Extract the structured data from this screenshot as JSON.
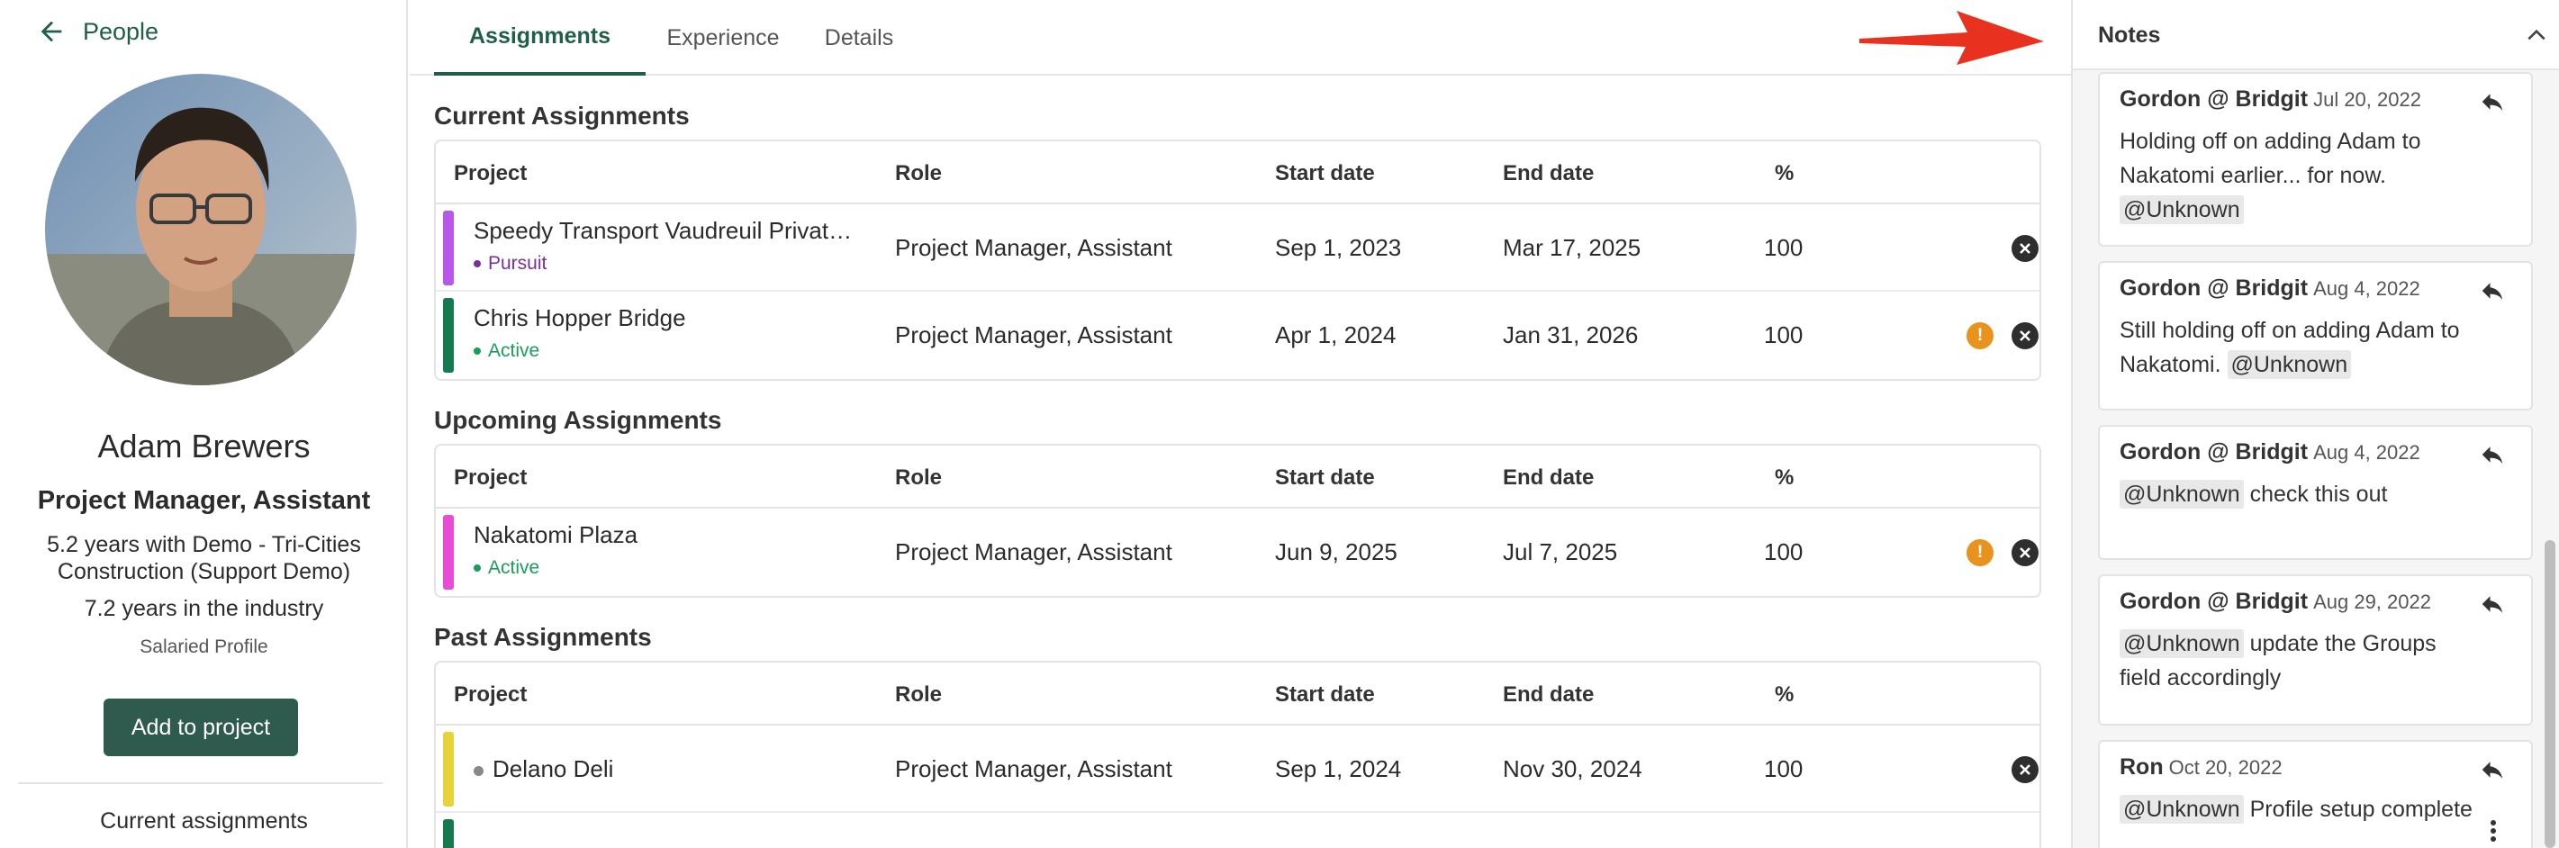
{
  "left_panel": {
    "back_label": "People",
    "name": "Adam Brewers",
    "role": "Project Manager, Assistant",
    "years_company": "5.2 years with Demo - Tri-Cities Construction (Support Demo)",
    "years_industry": "7.2 years in the industry",
    "profile_type": "Salaried Profile",
    "add_button": "Add to project",
    "current_assignments_label": "Current assignments"
  },
  "tabs": [
    {
      "label": "Assignments",
      "active": true
    },
    {
      "label": "Experience",
      "active": false
    },
    {
      "label": "Details",
      "active": false
    }
  ],
  "columns": {
    "project": "Project",
    "role": "Role",
    "start": "Start date",
    "end": "End date",
    "pct": "%"
  },
  "sections": {
    "current": {
      "title": "Current Assignments",
      "rows": [
        {
          "project": "Speedy Transport Vaudreuil Privat…",
          "status": "Pursuit",
          "status_color": "#7a2d9c",
          "stripe": "#b857e8",
          "role": "Project Manager, Assistant",
          "start": "Sep 1, 2023",
          "end": "Mar 17, 2025",
          "pct": "100",
          "warning": false
        },
        {
          "project": "Chris Hopper Bridge",
          "status": "Active",
          "status_color": "#1a9c5b",
          "stripe": "#157a50",
          "role": "Project Manager, Assistant",
          "start": "Apr 1, 2024",
          "end": "Jan 31, 2026",
          "pct": "100",
          "warning": true
        }
      ]
    },
    "upcoming": {
      "title": "Upcoming Assignments",
      "rows": [
        {
          "project": "Nakatomi Plaza",
          "status": "Active",
          "status_color": "#1a9c5b",
          "stripe": "#e84bd6",
          "role": "Project Manager, Assistant",
          "start": "Jun 9, 2025",
          "end": "Jul 7, 2025",
          "pct": "100",
          "warning": true
        }
      ]
    },
    "past": {
      "title": "Past Assignments",
      "rows": [
        {
          "project": "Delano Deli",
          "status": "",
          "status_color": "#888888",
          "stripe": "#e8d23a",
          "role": "Project Manager, Assistant",
          "start": "Sep 1, 2024",
          "end": "Nov 30, 2024",
          "pct": "100",
          "warning": false
        }
      ]
    }
  },
  "notes": {
    "title": "Notes",
    "items": [
      {
        "author": "Gordon @ Bridgit",
        "date": "Jul 20, 2022",
        "text": "Holding off on adding Adam to Nakatomi earlier... for now.",
        "mention": "@Unknown",
        "mention_first": false
      },
      {
        "author": "Gordon @ Bridgit",
        "date": "Aug 4, 2022",
        "text": "Still holding off on adding Adam to Nakatomi.",
        "mention": "@Unknown",
        "mention_first": false
      },
      {
        "author": "Gordon @ Bridgit",
        "date": "Aug 4, 2022",
        "text": "check this out",
        "mention": "@Unknown",
        "mention_first": true
      },
      {
        "author": "Gordon @ Bridgit",
        "date": "Aug 29, 2022",
        "text": "update the Groups field accordingly",
        "mention": "@Unknown",
        "mention_first": true
      },
      {
        "author": "Ron",
        "date": "Oct 20, 2022",
        "text": "Profile setup complete",
        "mention": "@Unknown",
        "mention_first": true
      }
    ]
  },
  "icons": {
    "back": "arrow-left-icon",
    "reply": "reply-icon",
    "remove": "close-circle-icon",
    "warning": "warning-icon",
    "collapse": "chevron-up-icon",
    "more": "kebab-menu-icon"
  },
  "colors": {
    "brand": "#2f5b4e",
    "accent_text": "#1f5e4a",
    "warning": "#e8931e",
    "annotation_arrow": "#e8321f"
  }
}
